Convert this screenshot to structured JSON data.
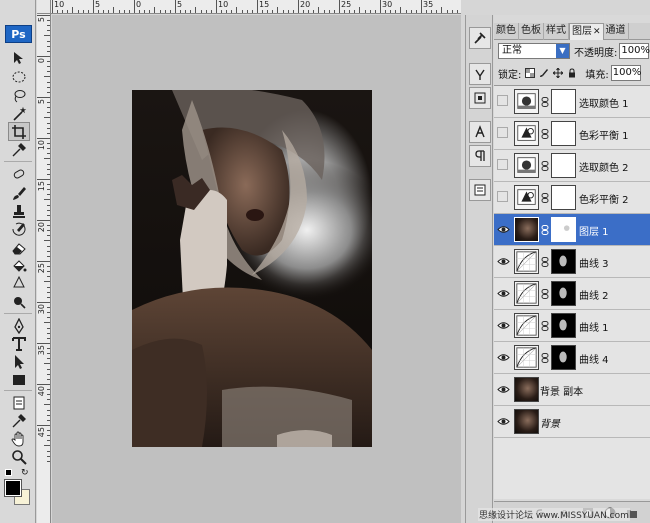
{
  "app": {
    "logo": "Ps"
  },
  "ruler": {
    "top_labels": [
      "10",
      "5",
      "0",
      "5",
      "10",
      "15",
      "20",
      "25",
      "30",
      "35"
    ],
    "left_labels": [
      "5",
      "0",
      "5",
      "10",
      "15",
      "20",
      "25",
      "30",
      "35",
      "40",
      "45"
    ]
  },
  "toolbox": {
    "tools": [
      "move-tool-icon",
      "marquee-tool-icon",
      "lasso-tool-icon",
      "magic-wand-icon",
      "crop-tool-icon",
      "eyedropper-icon",
      "healing-brush-icon",
      "brush-icon",
      "clone-stamp-icon",
      "history-brush-icon",
      "eraser-icon",
      "paint-bucket-icon",
      "blur-icon",
      "dodge-icon",
      "pen-tool-icon",
      "type-tool-icon",
      "path-select-icon",
      "shape-tool-icon",
      "notes-icon",
      "eyedropper-2-icon",
      "hand-icon",
      "zoom-icon"
    ],
    "foreground_color": "#000000",
    "background_color": "#f7f2d7"
  },
  "panel": {
    "tabs": [
      "颜色",
      "色板",
      "样式",
      "图层",
      "通道"
    ],
    "active_tab": "图层",
    "blend_mode": "正常",
    "opacity_label": "不透明度:",
    "opacity_value": "100%",
    "lock_label": "锁定:",
    "fill_label": "填充:",
    "fill_value": "100%",
    "layers": [
      {
        "name": "选取颜色 1",
        "kind": "selective-color",
        "visible": false,
        "selected": false
      },
      {
        "name": "色彩平衡 1",
        "kind": "color-balance",
        "visible": false,
        "selected": false
      },
      {
        "name": "选取颜色 2",
        "kind": "selective-color",
        "visible": false,
        "selected": false
      },
      {
        "name": "色彩平衡 2",
        "kind": "color-balance",
        "visible": false,
        "selected": false
      },
      {
        "name": "图层 1",
        "kind": "image-mask",
        "visible": true,
        "selected": true
      },
      {
        "name": "曲线 3",
        "kind": "curves",
        "visible": true,
        "selected": false
      },
      {
        "name": "曲线 2",
        "kind": "curves",
        "visible": true,
        "selected": false
      },
      {
        "name": "曲线 1",
        "kind": "curves",
        "visible": true,
        "selected": false
      },
      {
        "name": "曲线 4",
        "kind": "curves",
        "visible": true,
        "selected": false
      },
      {
        "name": "背景 副本",
        "kind": "image",
        "visible": true,
        "selected": false
      },
      {
        "name": "背景",
        "kind": "image-locked",
        "visible": true,
        "selected": false
      }
    ]
  },
  "colors": {
    "selection": "#3b6ec7",
    "accent": "#1e66c4"
  },
  "watermark": "思缘设计论坛 www.MISSYUAN.com"
}
